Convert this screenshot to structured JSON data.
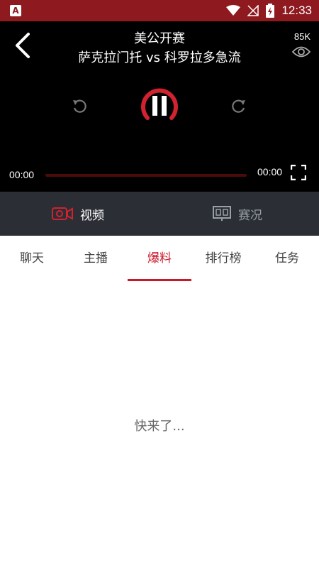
{
  "status_bar": {
    "time": "12:33",
    "icons": [
      "app-notification-icon",
      "wifi-icon",
      "no-signal-icon",
      "battery-charging-icon"
    ]
  },
  "player": {
    "title_line1": "美公开赛",
    "title_line2": "萨克拉门托 vs 科罗拉多急流",
    "viewer_count": "85K",
    "current_time": "00:00",
    "duration": "00:00",
    "progress": 0,
    "accent_color": "#d0222f"
  },
  "mode_tabs": [
    {
      "label": "视频",
      "icon": "video-camera-icon",
      "active": true
    },
    {
      "label": "赛况",
      "icon": "scoreboard-icon",
      "active": false
    }
  ],
  "tabs": [
    {
      "label": "聊天"
    },
    {
      "label": "主播"
    },
    {
      "label": "爆料"
    },
    {
      "label": "排行榜"
    },
    {
      "label": "任务"
    }
  ],
  "active_tab_index": 2,
  "content": {
    "placeholder": "快来了..."
  }
}
